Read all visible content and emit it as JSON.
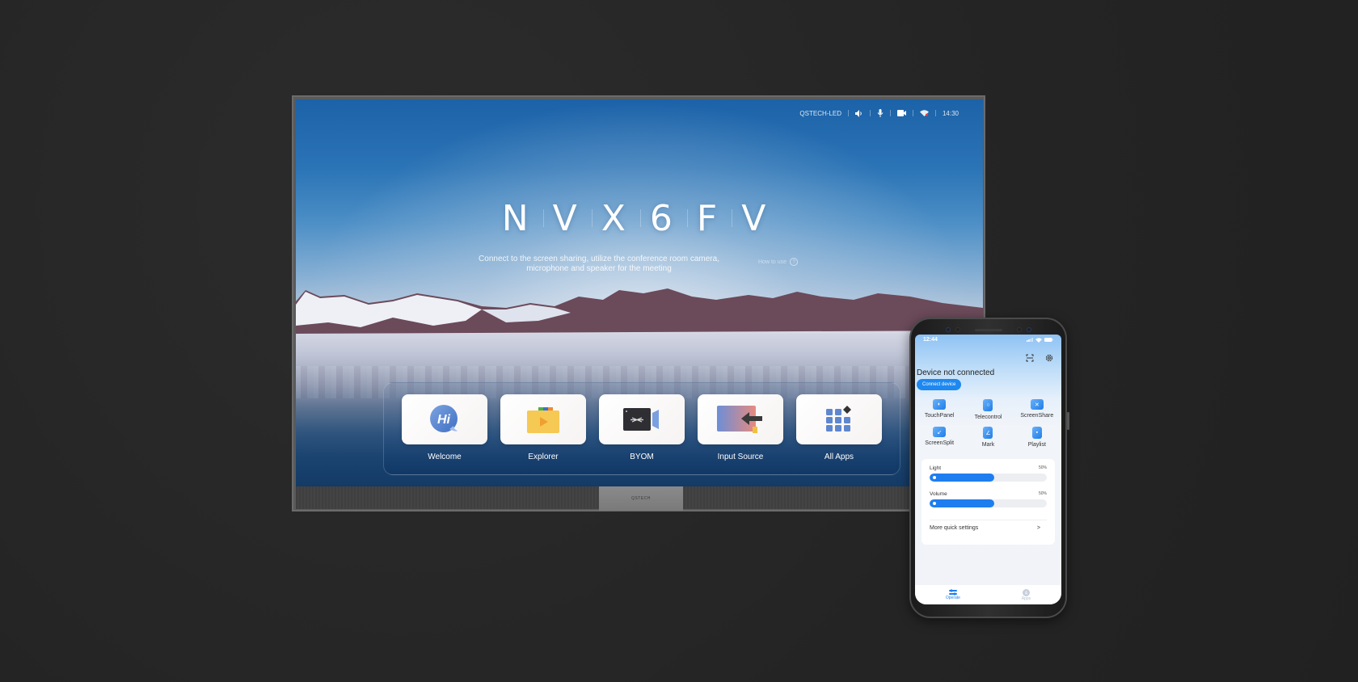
{
  "tv": {
    "status_bar": {
      "device_name": "QSTECH-LED",
      "icons": [
        "speaker-icon",
        "microphone-icon",
        "camera-icon",
        "wifi-icon"
      ],
      "time": "14:30"
    },
    "room_code_chars": [
      "N",
      "V",
      "X",
      "6",
      "F",
      "V"
    ],
    "subtitle_line1": "Connect to the screen sharing, utilize the conference room camera,",
    "subtitle_line2": "microphone and speaker for the meeting",
    "how_to_use": "How to use",
    "how_to_icon": "?",
    "apps": [
      {
        "label": "Welcome",
        "icon": "hi-chat-icon"
      },
      {
        "label": "Explorer",
        "icon": "folder-play-icon"
      },
      {
        "label": "BYOM",
        "icon": "byom-camera-icon"
      },
      {
        "label": "Input Source",
        "icon": "input-source-icon"
      },
      {
        "label": "All Apps",
        "icon": "app-grid-icon"
      }
    ],
    "bezel_logo": "QSTECH"
  },
  "phone": {
    "time": "12:44",
    "title": "Device not connected",
    "connect_button": "Connect device",
    "tools": [
      {
        "label": "TouchPanel",
        "icon": "touch-panel-icon"
      },
      {
        "label": "Telecontrol",
        "icon": "telecontrol-icon"
      },
      {
        "label": "ScreenShare",
        "icon": "screen-share-icon"
      },
      {
        "label": "ScreenSplit",
        "icon": "screen-split-icon"
      },
      {
        "label": "Mark",
        "icon": "mark-icon"
      },
      {
        "label": "Playlist",
        "icon": "playlist-icon"
      }
    ],
    "sliders": [
      {
        "label": "Light",
        "value_text": "50%",
        "value": 0.55
      },
      {
        "label": "Volume",
        "value_text": "50%",
        "value": 0.55
      }
    ],
    "more_settings": "More quick settings",
    "more_chevron": ">",
    "tabs": [
      {
        "label": "Operate",
        "active": true
      },
      {
        "label": "Apps",
        "active": false
      }
    ],
    "accent_color": "#1e7ef0"
  }
}
